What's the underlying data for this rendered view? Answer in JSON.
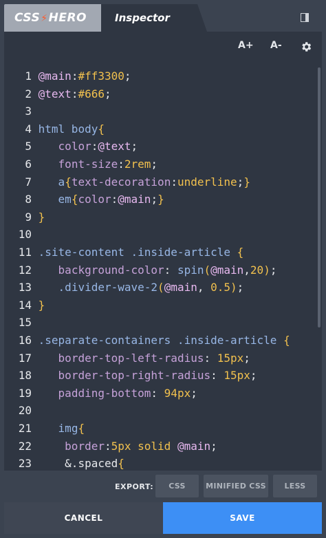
{
  "tabs": {
    "logo_prefix": "CSS",
    "logo_suffix": "HERO",
    "active": "Inspector"
  },
  "toolbar": {
    "font_increase": "A+",
    "font_decrease": "A-"
  },
  "colors": {
    "number": "#e7e9ec",
    "variable": "#e8b9f0",
    "hex": "#f2c14e",
    "plain": "#e7e9ec",
    "property": "#c6a2d9",
    "selector": "#98b7e6",
    "paren": "#f2c14e",
    "accent": "#3d8ff5"
  },
  "code_lines": [
    {
      "num": "1",
      "tokens": [
        [
          "@main",
          "variable"
        ],
        [
          ":",
          "plain"
        ],
        [
          "#ff3300",
          "hex"
        ],
        [
          ";",
          "plain"
        ]
      ]
    },
    {
      "num": "2",
      "tokens": [
        [
          "@text",
          "variable"
        ],
        [
          ":",
          "plain"
        ],
        [
          "#666",
          "hex"
        ],
        [
          ";",
          "plain"
        ]
      ]
    },
    {
      "num": "3",
      "tokens": []
    },
    {
      "num": "4",
      "tokens": [
        [
          "html body",
          "selector"
        ],
        [
          "{",
          "paren"
        ]
      ]
    },
    {
      "num": "5",
      "tokens": [
        [
          "   ",
          "plain"
        ],
        [
          "color",
          "property"
        ],
        [
          ":",
          "plain"
        ],
        [
          "@text",
          "variable"
        ],
        [
          ";",
          "plain"
        ]
      ]
    },
    {
      "num": "6",
      "tokens": [
        [
          "   ",
          "plain"
        ],
        [
          "font-size",
          "property"
        ],
        [
          ":",
          "plain"
        ],
        [
          "2rem",
          "hex"
        ],
        [
          ";",
          "plain"
        ]
      ]
    },
    {
      "num": "7",
      "tokens": [
        [
          "   ",
          "plain"
        ],
        [
          "a",
          "selector"
        ],
        [
          "{",
          "paren"
        ],
        [
          "text-decoration",
          "property"
        ],
        [
          ":",
          "plain"
        ],
        [
          "underline",
          "hex"
        ],
        [
          ";",
          "plain"
        ],
        [
          "}",
          "paren"
        ]
      ]
    },
    {
      "num": "8",
      "tokens": [
        [
          "   ",
          "plain"
        ],
        [
          "em",
          "selector"
        ],
        [
          "{",
          "paren"
        ],
        [
          "color",
          "property"
        ],
        [
          ":",
          "plain"
        ],
        [
          "@main",
          "variable"
        ],
        [
          ";",
          "plain"
        ],
        [
          "}",
          "paren"
        ]
      ]
    },
    {
      "num": "9",
      "tokens": [
        [
          "}",
          "paren"
        ]
      ]
    },
    {
      "num": "10",
      "tokens": []
    },
    {
      "num": "11",
      "tokens": [
        [
          ".site-content .inside-article ",
          "selector"
        ],
        [
          "{",
          "paren"
        ]
      ]
    },
    {
      "num": "12",
      "tokens": [
        [
          "   ",
          "plain"
        ],
        [
          "background-color",
          "property"
        ],
        [
          ": ",
          "plain"
        ],
        [
          "spin",
          "selector"
        ],
        [
          "(",
          "paren"
        ],
        [
          "@main",
          "variable"
        ],
        [
          ",",
          "plain"
        ],
        [
          "20",
          "hex"
        ],
        [
          ")",
          "paren"
        ],
        [
          ";",
          "plain"
        ]
      ]
    },
    {
      "num": "13",
      "tokens": [
        [
          "   ",
          "plain"
        ],
        [
          ".divider-wave-2",
          "selector"
        ],
        [
          "(",
          "paren"
        ],
        [
          "@main",
          "variable"
        ],
        [
          ", ",
          "plain"
        ],
        [
          "0.5",
          "hex"
        ],
        [
          ")",
          "paren"
        ],
        [
          ";",
          "plain"
        ]
      ]
    },
    {
      "num": "14",
      "tokens": [
        [
          "}",
          "paren"
        ]
      ]
    },
    {
      "num": "15",
      "tokens": []
    },
    {
      "num": "16",
      "tokens": [
        [
          ".separate-containers .inside-article ",
          "selector"
        ],
        [
          "{",
          "paren"
        ]
      ]
    },
    {
      "num": "17",
      "tokens": [
        [
          "   ",
          "plain"
        ],
        [
          "border-top-left-radius",
          "property"
        ],
        [
          ": ",
          "plain"
        ],
        [
          "15px",
          "hex"
        ],
        [
          ";",
          "plain"
        ]
      ]
    },
    {
      "num": "18",
      "tokens": [
        [
          "   ",
          "plain"
        ],
        [
          "border-top-right-radius",
          "property"
        ],
        [
          ": ",
          "plain"
        ],
        [
          "15px",
          "hex"
        ],
        [
          ";",
          "plain"
        ]
      ]
    },
    {
      "num": "19",
      "tokens": [
        [
          "   ",
          "plain"
        ],
        [
          "padding-bottom",
          "property"
        ],
        [
          ": ",
          "plain"
        ],
        [
          "94px",
          "hex"
        ],
        [
          ";",
          "plain"
        ]
      ]
    },
    {
      "num": "20",
      "tokens": []
    },
    {
      "num": "21",
      "tokens": [
        [
          "   ",
          "plain"
        ],
        [
          "img",
          "selector"
        ],
        [
          "{",
          "paren"
        ]
      ]
    },
    {
      "num": "22",
      "tokens": [
        [
          "    ",
          "plain"
        ],
        [
          "border",
          "property"
        ],
        [
          ":",
          "plain"
        ],
        [
          "5px solid ",
          "hex"
        ],
        [
          "@main",
          "variable"
        ],
        [
          ";",
          "plain"
        ]
      ]
    },
    {
      "num": "23",
      "tokens": [
        [
          "    ",
          "plain"
        ],
        [
          "&.spaced",
          "plain"
        ],
        [
          "{",
          "paren"
        ]
      ]
    }
  ],
  "export": {
    "label": "EXPORT:",
    "css": "CSS",
    "minified": "MINIFIED CSS",
    "less": "LESS"
  },
  "footer": {
    "cancel": "CANCEL",
    "save": "SAVE"
  }
}
